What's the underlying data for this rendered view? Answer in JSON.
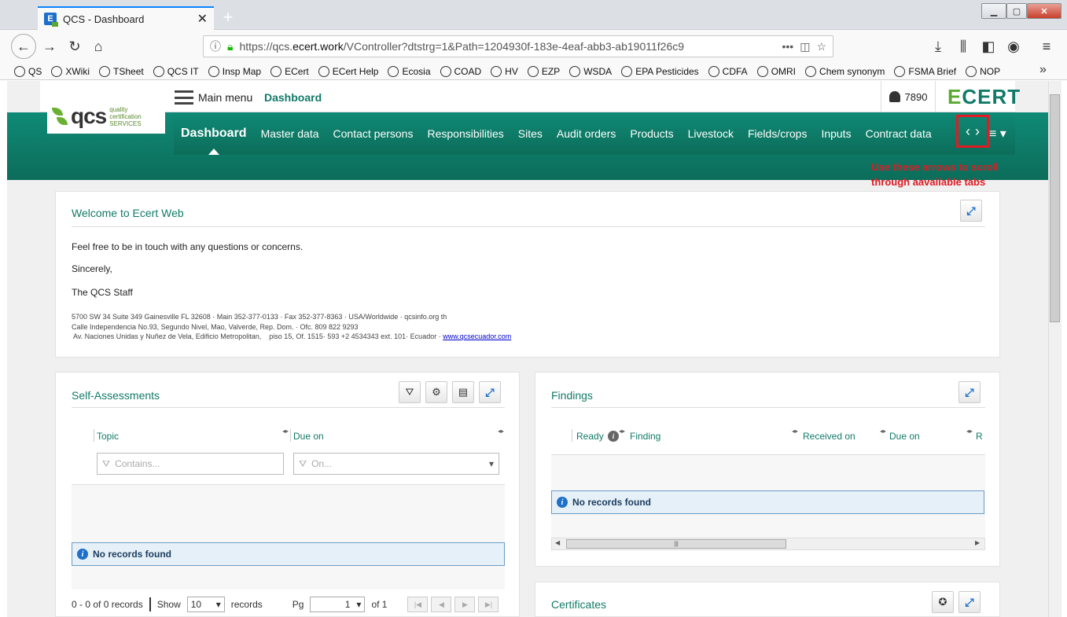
{
  "browser": {
    "tab_title": "QCS - Dashboard",
    "tab_close": "✕",
    "new_tab": "+",
    "url_prefix": "https://qcs.",
    "url_domain": "ecert.work",
    "url_path": "/VController?dtstrg=1&Path=1204930f-183e-4eaf-abb3-ab19011f26c9",
    "url_more": "•••",
    "bookmarks": [
      "QS",
      "XWiki",
      "TSheet",
      "QCS IT",
      "Insp Map",
      "ECert",
      "ECert Help",
      "Ecosia",
      "COAD",
      "HV",
      "EZP",
      "WSDA",
      "EPA Pesticides",
      "CDFA",
      "OMRI",
      "Chem synonym",
      "FSMA Brief",
      "NOP"
    ],
    "bookmarks_more": "»"
  },
  "app": {
    "logo_text": "qcs",
    "logo_sub1": "quality",
    "logo_sub2": "certification",
    "logo_sub3": "SERVICES",
    "main_menu_label": "Main menu",
    "breadcrumb": "Dashboard",
    "user_id": "7890",
    "brand_e": "E",
    "brand_rest": "CERT",
    "tabs": [
      "Dashboard",
      "Master data",
      "Contact persons",
      "Responsibilities",
      "Sites",
      "Audit orders",
      "Products",
      "Livestock",
      "Fields/crops",
      "Inputs",
      "Contract data"
    ],
    "arrow_left": "‹",
    "arrow_right": "›",
    "tab_menu": "≡ ▾",
    "hint_line1": "Use these arrows to scroll",
    "hint_line2": "through aavailable tabs"
  },
  "welcome": {
    "title": "Welcome to Ecert Web",
    "line1": "Feel free to be in touch with any questions or concerns.",
    "line2": "Sincerely,",
    "line3": "The QCS Staff",
    "addr1": "5700 SW 34 Suite 349 Gainesville FL 32608 · Main 352-377-0133 · Fax 352-377-8363 · USA/Worldwide · qcsinfo.org th",
    "addr2": "Calle Independencia No.93, Segundo Nivel, Mao, Valverde, Rep. Dom. · Ofc. 809 822 9293",
    "addr3": " Av. Naciones Unidas y Nuñez de Vela, Edificio Metropolitan,    piso 15, Of. 1515· 593 +2 4534343 ext. 101· Ecuador · ",
    "addr3_link": "www.qcsecuador.com"
  },
  "self_assessments": {
    "title": "Self-Assessments",
    "col_topic": "Topic",
    "col_due": "Due on",
    "filter_topic_placeholder": "Contains...",
    "filter_due_placeholder": "On...",
    "no_records": "No records found",
    "summary": "0 - 0 of 0 records",
    "show_label": "Show",
    "show_value": "10",
    "records_label": "records",
    "pg_label": "Pg",
    "pg_value": "1",
    "of_label": "of 1"
  },
  "findings": {
    "title": "Findings",
    "col_ready": "Ready",
    "col_finding": "Finding",
    "col_received": "Received on",
    "col_due": "Due on",
    "col_r": "R",
    "no_records": "No records found",
    "scroll_grip": "|||"
  },
  "certificates": {
    "title": "Certificates"
  },
  "colors": {
    "accent": "#117a68",
    "green_bar": "#0f8a76",
    "hint_red": "#e01b24",
    "info_blue": "#1e6fc9"
  }
}
